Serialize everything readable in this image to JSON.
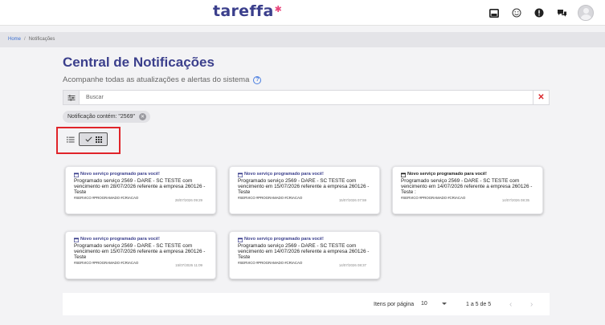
{
  "app": {
    "logo_text": "tareffa"
  },
  "breadcrumb": {
    "home": "Home",
    "separator": "/",
    "current": "Notificações"
  },
  "page": {
    "title": "Central de Notificações",
    "subtitle": "Acompanhe todas as atualizações e alertas do sistema"
  },
  "search": {
    "placeholder": "Buscar",
    "value": ""
  },
  "filter_chip": {
    "label": "Notificação contém: \"2569\""
  },
  "cards": [
    {
      "title": "Novo serviço programado para você!",
      "line1": "Programado serviço 2569 - DARE - SC TESTE com",
      "line2": "vencimento em 28/07/2026 referente a empresa 260126 -",
      "line3": "Teste",
      "tags": "#SERVICO #PROGRAMADO #CRIACAO",
      "date": "28/07/2026 09:29"
    },
    {
      "title": "Novo serviço programado para você!",
      "line1": "Programado serviço 2569 - DARE - SC TESTE com",
      "line2": "vencimento em 15/07/2026 referente a empresa 260126 -",
      "line3": "Teste",
      "tags": "#SERVICO #PROGRAMADO #CRIACAO",
      "date": "15/07/2026 07:59"
    },
    {
      "title": "Novo serviço programado para você!",
      "line1": "Programado serviço 2569 - DARE - SC TESTE com",
      "line2": "vencimento em 14/07/2026 referente a empresa 260126 -",
      "line3": "Teste :",
      "tags": "#SERVICO #PROGRAMADO #CRIACAO",
      "date": "14/07/2026 08:35"
    },
    {
      "title": "Novo serviço programado para você!",
      "line1": "Programado serviço 2569 - DARE - SC TESTE com",
      "line2": "vencimento em 15/07/2026 referente a empresa 260126 -",
      "line3": "Teste",
      "tags": "#SERVICO #PROGRAMADO #CRIACAO",
      "date": "15/07/2026 11:09"
    },
    {
      "title": "Novo serviço programado para você!",
      "line1": "Programado serviço 2569 - DARE - SC TESTE com",
      "line2": "vencimento em 14/07/2026 referente a empresa 260126 -",
      "line3": "Teste",
      "tags": "#SERVICO #PROGRAMADO #CRIACAO",
      "date": "14/07/2026 08:37"
    }
  ],
  "pagination": {
    "items_label": "Itens por página",
    "page_size": "10",
    "range": "1 a 5 de 5"
  },
  "colors": {
    "brand": "#3b3f8c",
    "accent": "#e8467c",
    "highlight_border": "#e0242a",
    "clear": "#d9262b"
  },
  "icons": {
    "topbar": [
      "inbox-icon",
      "smiley-icon",
      "alert-icon",
      "chat-icon",
      "avatar"
    ],
    "search": [
      "filter-sliders-icon",
      "close-icon"
    ],
    "view": [
      "list-view-icon",
      "check-icon",
      "grid-view-icon"
    ],
    "card": "calendar-icon"
  }
}
